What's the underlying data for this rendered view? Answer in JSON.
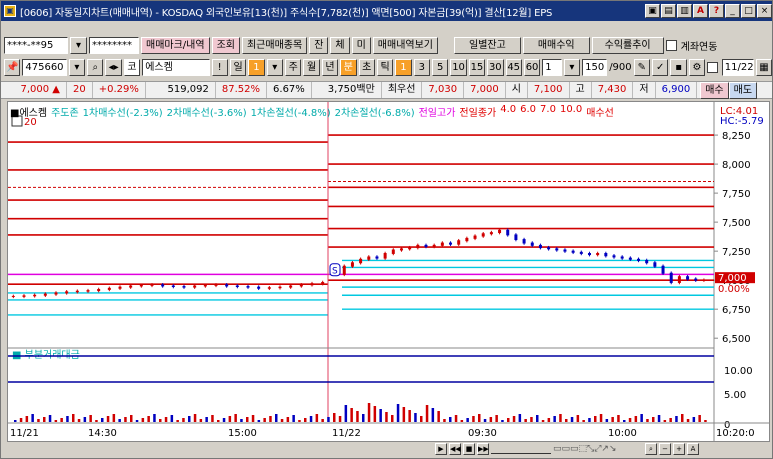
{
  "window": {
    "title": "[0606] 자동일지차트(매매내역) - KOSDAQ 외국인보유[13(천)] 주식수[7,782(천)] 액면[500] 자본금[39(억)] 결산[12월] EPS",
    "buttons": [
      "▣",
      "▤",
      "▥",
      "A",
      "?",
      "_",
      "□",
      "×"
    ]
  },
  "toolbar1": {
    "account": "****-**95",
    "password": "********",
    "trade_mark_label": "매매마크/내역",
    "query_label": "조회",
    "recent_label": "최근매매종목",
    "jan_label": "잔",
    "che_label": "체",
    "mi_label": "미",
    "trade_history_label": "매매내역보기",
    "daily_balance_label": "일별잔고",
    "trade_profit_label": "매매수익",
    "return_label": "수익률추이",
    "account_link_label": "계좌연동"
  },
  "toolbar2": {
    "code": "475660",
    "name_prefix": "코",
    "stock_name": "에스켐",
    "period_labels": [
      "일",
      "1",
      "주",
      "월",
      "년",
      "분",
      "초",
      "틱"
    ],
    "interval_labels": [
      "1",
      "3",
      "5",
      "10",
      "15",
      "30",
      "45",
      "60"
    ],
    "interval_value": "1",
    "count": "150",
    "count_max": "/900",
    "date": "11/22"
  },
  "pricebar": {
    "price": "7,000 ▲",
    "change": "20",
    "change_pct": "+0.29%",
    "volume": "519,092",
    "volume_ratio": "87.52%",
    "turnover": "6.67%",
    "amount": "3,750백만",
    "high_label": "최우선",
    "best_ask": "7,030",
    "best_bid": "7,000",
    "open_label": "시",
    "open": "7,100",
    "high_price_label": "고",
    "high": "7,430",
    "low_label": "저",
    "low": "6,900",
    "buy_label": "매수",
    "sell_label": "매도"
  },
  "legend": {
    "name": "에스켐",
    "items": [
      {
        "text": "주도존",
        "color": "#00aaaa"
      },
      {
        "text": "1차매수선(-2.3%)",
        "color": "#00aaaa"
      },
      {
        "text": "2차매수선(-3.6%)",
        "color": "#00aaaa"
      },
      {
        "text": "1차손절선(-4.8%)",
        "color": "#00aaaa"
      },
      {
        "text": "2차손절선(-6.8%)",
        "color": "#00aaaa"
      },
      {
        "text": "전일고가",
        "color": "#e000e0"
      },
      {
        "text": "전일종가",
        "color": "#e00000"
      },
      {
        "text": "4.0",
        "color": "#e00000"
      },
      {
        "text": "6.0",
        "color": "#e00000"
      },
      {
        "text": "7.0",
        "color": "#e00000"
      },
      {
        "text": "10.0",
        "color": "#e00000"
      },
      {
        "text": "매수선",
        "color": "#e00000"
      }
    ],
    "lc_label": "LC:4.01",
    "hc_label": "HC:-5.79",
    "badge": "20",
    "buy_marker": "S"
  },
  "sub_legend": "부분거래대금",
  "chart_data": {
    "type": "line",
    "price_axis": [
      "8,250",
      "8,000",
      "7,750",
      "7,500",
      "7,250",
      "7,000",
      "6,750",
      "6,500"
    ],
    "price_ticks": [
      8250,
      8000,
      7750,
      7500,
      7250,
      7000,
      6750,
      6500
    ],
    "price_range": [
      6450,
      8380
    ],
    "last_price_label": "7,000",
    "last_pct_label": "0.00%",
    "sub_axis": [
      "10.00",
      "5.00",
      "0"
    ],
    "x_labels": [
      "11/21",
      "14:30",
      "15:00",
      "11/22",
      "09:30",
      "10:00",
      "10:20:0"
    ],
    "day1_levels": {
      "red": [
        6965,
        7390,
        7530,
        7690,
        7950,
        8190
      ],
      "cyan": [
        6830,
        6890,
        6700
      ],
      "dashed": [
        7800
      ]
    },
    "day2_levels": {
      "red": [
        7000,
        7285,
        7445,
        7635,
        7800,
        8000,
        8250
      ],
      "cyan": [
        6750,
        6870,
        6940,
        7110,
        7170
      ],
      "magenta": [
        7050
      ],
      "dashed": [
        7850
      ]
    },
    "day1_series": [
      6860,
      6865,
      6870,
      6880,
      6890,
      6900,
      6905,
      6910,
      6920,
      6930,
      6940,
      6950,
      6955,
      6960,
      6950,
      6945,
      6940,
      6950,
      6955,
      6960,
      6950,
      6945,
      6940,
      6930,
      6935,
      6940,
      6950,
      6960,
      6970,
      6980
    ],
    "day2_series": [
      7050,
      7120,
      7150,
      7180,
      7200,
      7190,
      7230,
      7260,
      7270,
      7280,
      7300,
      7290,
      7300,
      7320,
      7310,
      7340,
      7360,
      7380,
      7400,
      7410,
      7430,
      7390,
      7350,
      7320,
      7300,
      7280,
      7270,
      7260,
      7250,
      7240,
      7230,
      7220,
      7230,
      7210,
      7200,
      7190,
      7180,
      7170,
      7150,
      7120,
      7060,
      6980,
      7030,
      7010,
      7000,
      7000
    ]
  }
}
